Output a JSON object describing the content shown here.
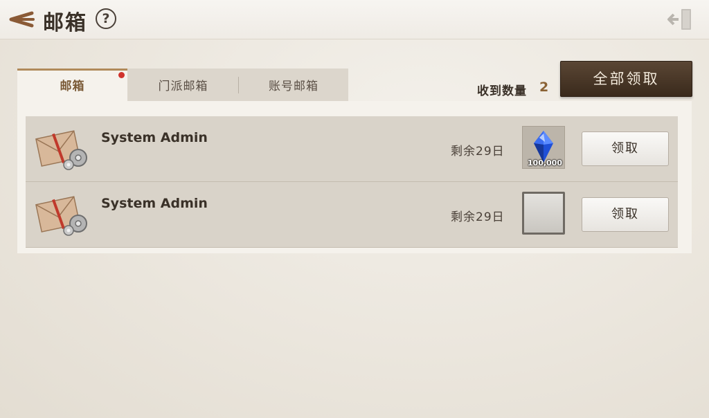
{
  "header": {
    "title": "邮箱",
    "help_label": "?",
    "back_icon": "back-arrow-icon",
    "exit_icon": "exit-door-icon"
  },
  "tabs": [
    {
      "label": "邮箱",
      "active": true,
      "has_notification": true
    },
    {
      "label": "门派邮箱",
      "active": false
    },
    {
      "label": "账号邮箱",
      "active": false
    }
  ],
  "summary": {
    "received_label": "收到数量",
    "received_count": "2",
    "claim_all_label": "全部领取"
  },
  "mails": [
    {
      "sender": "System Admin",
      "remaining": "剩余29日",
      "item": {
        "icon": "blue-crystal-icon",
        "quantity": "100,000"
      },
      "claim_label": "领取"
    },
    {
      "sender": "System Admin",
      "remaining": "剩余29日",
      "item": {
        "icon": "empty-slot",
        "quantity": ""
      },
      "claim_label": "领取"
    }
  ],
  "colors": {
    "accent": "#8a6234",
    "notification_dot": "#d0322c",
    "claim_all_bg": "#3a2a1c"
  }
}
